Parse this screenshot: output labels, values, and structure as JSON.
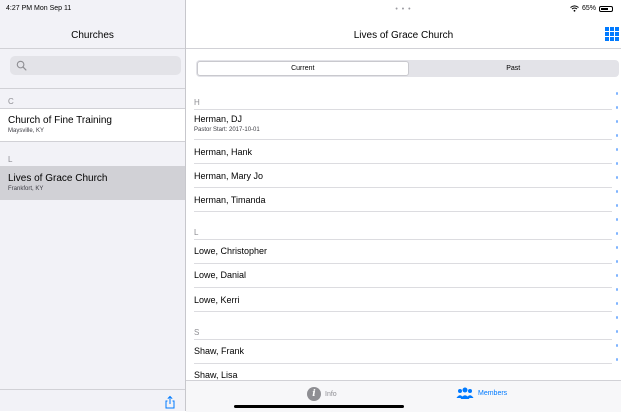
{
  "status": {
    "time_date": "4:27 PM  Mon Sep 11",
    "battery": "65%",
    "battery_level": 0.65
  },
  "sidebar": {
    "title": "Churches",
    "search_placeholder": "",
    "sections": [
      {
        "letter": "C",
        "churches": [
          {
            "name": "Church of Fine Training",
            "location": "Maysville, KY",
            "selected": false
          }
        ]
      },
      {
        "letter": "L",
        "churches": [
          {
            "name": "Lives of Grace Church",
            "location": "Frankfort, KY",
            "selected": true
          }
        ]
      }
    ]
  },
  "detail": {
    "title": "Lives of Grace Church",
    "segments": {
      "current": "Current",
      "past": "Past",
      "selected": "Current"
    },
    "sections": [
      {
        "letter": "H",
        "members": [
          {
            "name": "Herman, DJ",
            "subtitle": "Pastor Start: 2017-10-01"
          },
          {
            "name": "Herman, Hank"
          },
          {
            "name": "Herman, Mary Jo"
          },
          {
            "name": "Herman, Timanda"
          }
        ]
      },
      {
        "letter": "L",
        "members": [
          {
            "name": "Lowe, Christopher"
          },
          {
            "name": "Lowe, Danial"
          },
          {
            "name": "Lowe, Kerri"
          }
        ]
      },
      {
        "letter": "S",
        "members": [
          {
            "name": "Shaw, Frank"
          },
          {
            "name": "Shaw, Lisa"
          }
        ]
      }
    ]
  },
  "tabbar": {
    "info_label": "Info",
    "members_label": "Members",
    "selected": "Members"
  },
  "colors": {
    "accent": "#007aff",
    "selected_row": "#d1d1d6",
    "sidebar_bg": "#f2f2f7"
  }
}
